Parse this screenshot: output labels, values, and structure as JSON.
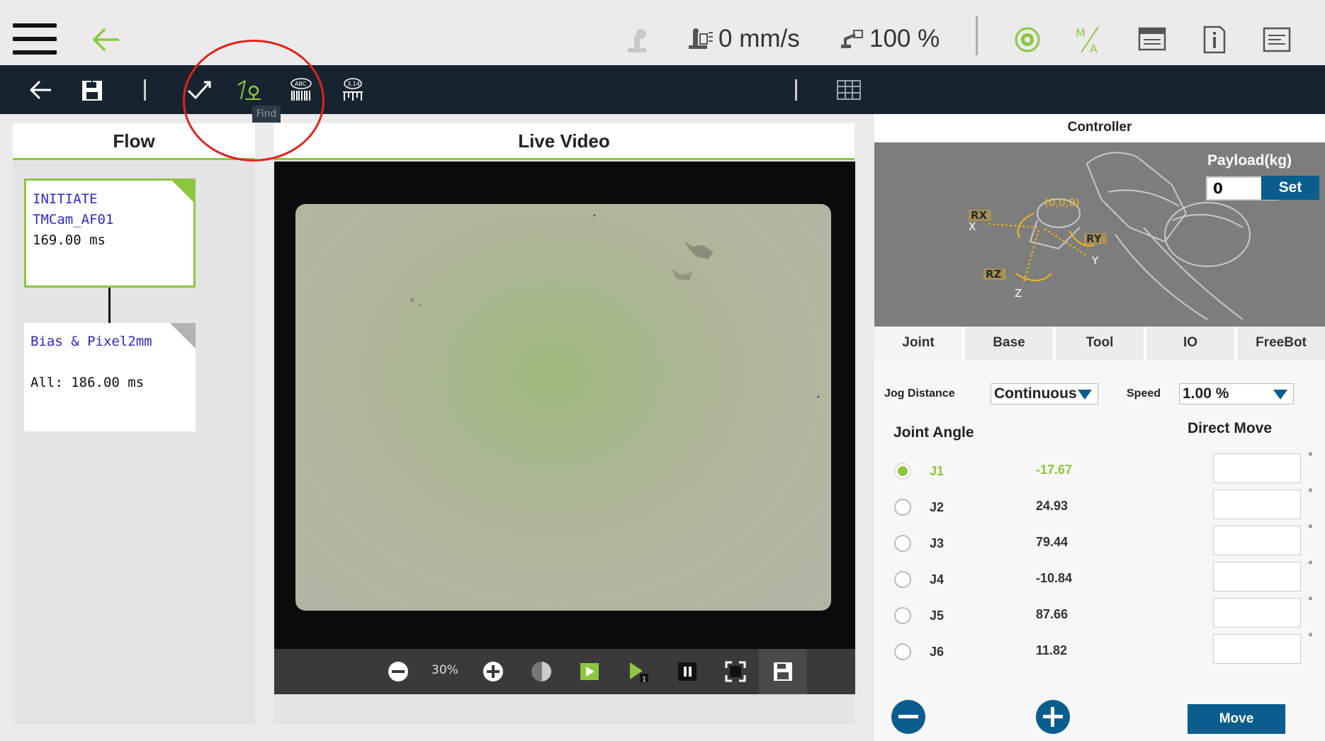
{
  "status": {
    "speed_text": "0 mm/s",
    "percent_text": "100 %"
  },
  "toolbar": {
    "tooltip": "Find"
  },
  "flow": {
    "title": "Flow",
    "nodes": [
      {
        "line1": "INITIATE",
        "line2": "TMCam_AF01",
        "line3": "169.00 ms"
      },
      {
        "line1": "Bias & Pixel2mm",
        "line3": "All: 186.00 ms"
      }
    ]
  },
  "video": {
    "title": "Live Video",
    "zoom": "30%"
  },
  "controller": {
    "title": "Controller",
    "payload_label": "Payload(kg)",
    "payload_value": "0",
    "set_label": "Set",
    "axes": {
      "rx": "RX",
      "ry": "RY",
      "rz": "RZ",
      "x": "X",
      "y": "Y",
      "z": "Z",
      "origin": "(0,0,0)"
    },
    "tabs": [
      "Joint",
      "Base",
      "Tool",
      "IO",
      "FreeBot"
    ],
    "jog_label": "Jog Distance",
    "jog_value": "Continuous",
    "speed_label": "Speed",
    "speed_value": "1.00 %",
    "joint_angle_title": "Joint Angle",
    "direct_move_title": "Direct Move",
    "deg_symbol": "°",
    "joints": [
      {
        "name": "J1",
        "value": "-17.67"
      },
      {
        "name": "J2",
        "value": "24.93"
      },
      {
        "name": "J3",
        "value": "79.44"
      },
      {
        "name": "J4",
        "value": "-10.84"
      },
      {
        "name": "J5",
        "value": "87.66"
      },
      {
        "name": "J6",
        "value": "11.82"
      }
    ],
    "move_label": "Move"
  },
  "colors": {
    "accent_green": "#8dc63f",
    "toolbar_dark": "#17242f",
    "button_blue": "#0b5d8e",
    "annotation_red": "#e0231d"
  }
}
